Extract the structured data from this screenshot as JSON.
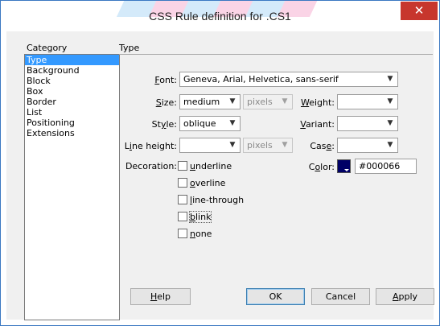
{
  "window": {
    "title": "CSS Rule definition for .CS1",
    "close_label": "✕"
  },
  "category": {
    "label": "Category",
    "items": [
      "Type",
      "Background",
      "Block",
      "Box",
      "Border",
      "List",
      "Positioning",
      "Extensions"
    ],
    "selected": "Type"
  },
  "panel_title": "Type",
  "fields": {
    "font": {
      "key": "F",
      "rest": "ont:",
      "value": "Geneva, Arial, Helvetica, sans-serif"
    },
    "size": {
      "key": "S",
      "rest": "ize:",
      "value": "medium",
      "unit": "pixels"
    },
    "weight": {
      "key": "W",
      "rest": "eight:",
      "value": ""
    },
    "style": {
      "pre": "St",
      "key": "y",
      "rest": "le:",
      "value": "oblique"
    },
    "variant": {
      "key": "V",
      "rest": "ariant:",
      "value": ""
    },
    "line_height": {
      "pre": "L",
      "key": "i",
      "rest": "ne height:",
      "value": "",
      "unit": "pixels"
    },
    "case": {
      "pre": "Cas",
      "key": "e",
      "rest": ":",
      "value": ""
    },
    "color": {
      "pre": "C",
      "key": "o",
      "rest": "lor:",
      "value": "#000066",
      "swatch": "#000066"
    },
    "decoration": {
      "label": "Decoration:",
      "underline": {
        "key": "u",
        "rest": "nderline"
      },
      "overline": {
        "key": "o",
        "rest": "verline"
      },
      "line_through": {
        "key": "l",
        "rest": "ine-through"
      },
      "blink": {
        "key": "b",
        "rest": "link"
      },
      "none": {
        "key": "n",
        "rest": "one"
      }
    }
  },
  "buttons": {
    "help": {
      "key": "H",
      "rest": "elp"
    },
    "ok": "OK",
    "cancel": "Cancel",
    "apply": {
      "key": "A",
      "rest": "pply"
    }
  }
}
